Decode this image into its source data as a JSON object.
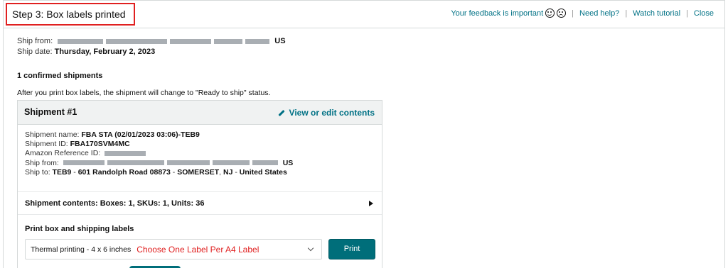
{
  "header": {
    "step_title": "Step 3: Box labels printed",
    "feedback_label": "Your feedback is important",
    "help_label": "Need help?",
    "tutorial_label": "Watch tutorial",
    "close_label": "Close",
    "separator": "|"
  },
  "ship_from": {
    "label": "Ship from:",
    "country": "US"
  },
  "ship_date": {
    "label": "Ship date:",
    "value": "Thursday, February 2, 2023"
  },
  "summary": {
    "title": "1 confirmed shipments",
    "info": "After you print box labels, the shipment will change to \"Ready to ship\" status."
  },
  "shipment": {
    "title": "Shipment #1",
    "edit_label": "View or edit contents",
    "name_label": "Shipment name:",
    "name_value": "FBA STA (02/01/2023 03:06)-TEB9",
    "id_label": "Shipment ID:",
    "id_value": "FBA170SVM4MC",
    "ref_label": "Amazon Reference ID:",
    "from_label": "Ship from:",
    "from_country": "US",
    "to_label": "Ship to:",
    "to_code": "TEB9",
    "to_address": "601 Randolph Road 08873",
    "to_city": "SOMERSET",
    "to_state": "NJ",
    "to_country": "United States",
    "dash": "-",
    "comma": ",",
    "contents_label": "Shipment contents: Boxes: 1, SKUs: 1, Units: 36",
    "print_title": "Print box and shipping labels",
    "print_option": "Thermal printing - 4 x 6 inches",
    "print_note": "Choose One Label Per A4 Label",
    "print_button": "Print"
  },
  "colors": {
    "accent": "#007185",
    "button": "#006e7a",
    "highlight": "#e02020"
  }
}
